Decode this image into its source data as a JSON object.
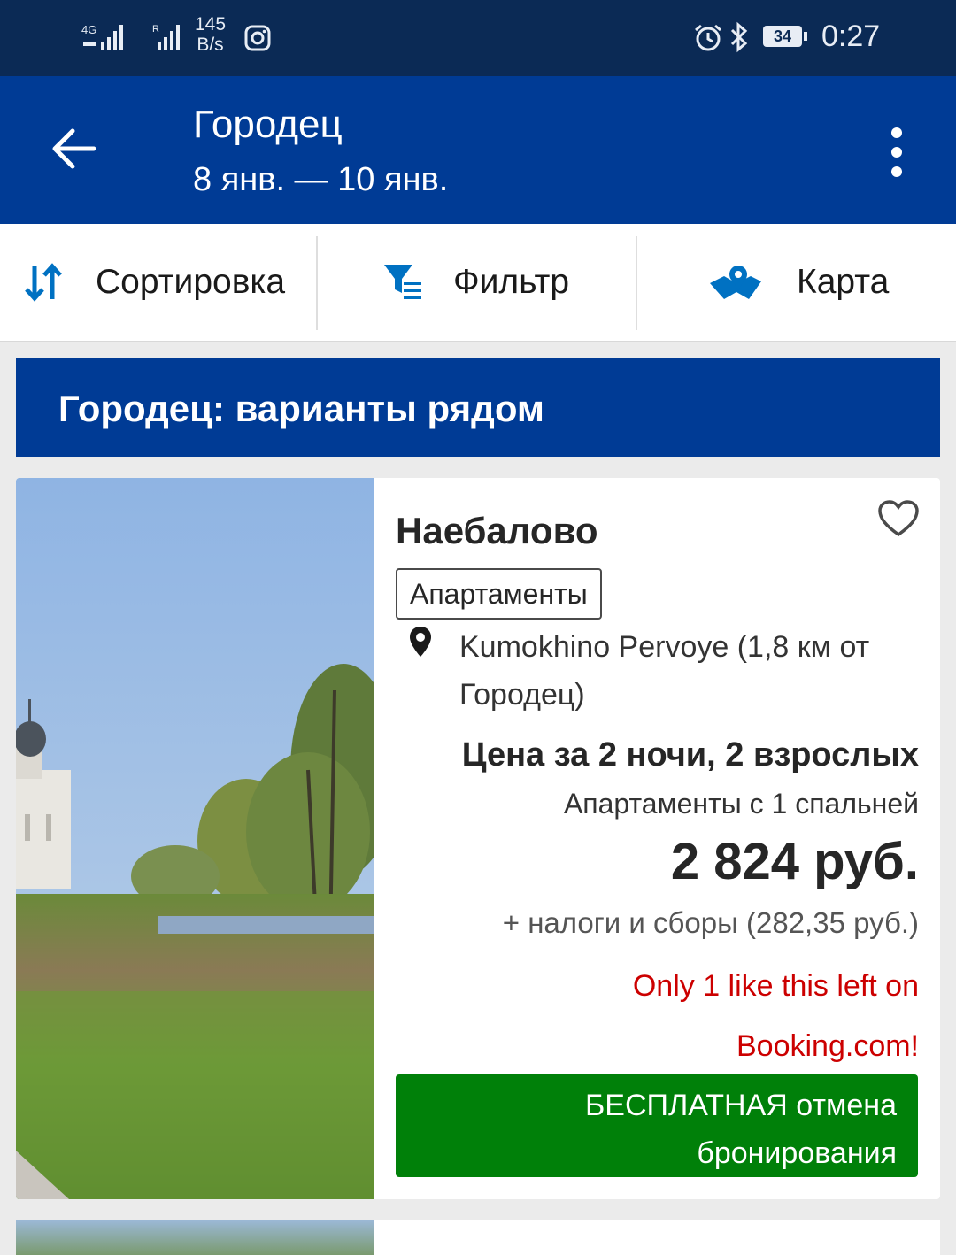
{
  "status_bar": {
    "net_speed_value": "145",
    "net_speed_unit": "B/s",
    "battery": "34",
    "time": "0:27",
    "network_type": "4G",
    "roaming": "R",
    "icons": [
      "signal-icon",
      "signal-icon",
      "instagram-icon",
      "alarm-icon",
      "bluetooth-icon",
      "battery-icon"
    ]
  },
  "header": {
    "title": "Городец",
    "dates": "8 янв. — 10 янв.",
    "icons": [
      "back-arrow-icon",
      "more-vert-icon"
    ]
  },
  "toolbar": {
    "sort_label": "Сортировка",
    "filter_label": "Фильтр",
    "map_label": "Карта",
    "icons": [
      "sort-icon",
      "filter-icon",
      "map-icon"
    ]
  },
  "section": {
    "title": "Городец: варианты рядом"
  },
  "listing": {
    "name": "Наебалово",
    "type_badge": "Апартаменты",
    "location": "Kumokhino Pervoye (1,8 км от Городец)",
    "price_label": "Цена за 2 ночи, 2 взрослых",
    "room_type": "Апартаменты с 1 спальней",
    "price": "2 824 руб.",
    "taxes": "+ налоги и сборы (282,35 руб.)",
    "scarcity": "Only 1 like this left on Booking.com!",
    "cancel_line1": "БЕСПЛАТНАЯ отмена",
    "cancel_line2": "бронирования",
    "icons": [
      "heart-icon",
      "location-pin-icon"
    ]
  },
  "colors": {
    "status_bar": "#0b2a55",
    "brand_blue": "#003b95",
    "toolbar_icon_blue": "#0071c2",
    "success_green": "#008009",
    "urgency_red": "#cc0000"
  }
}
